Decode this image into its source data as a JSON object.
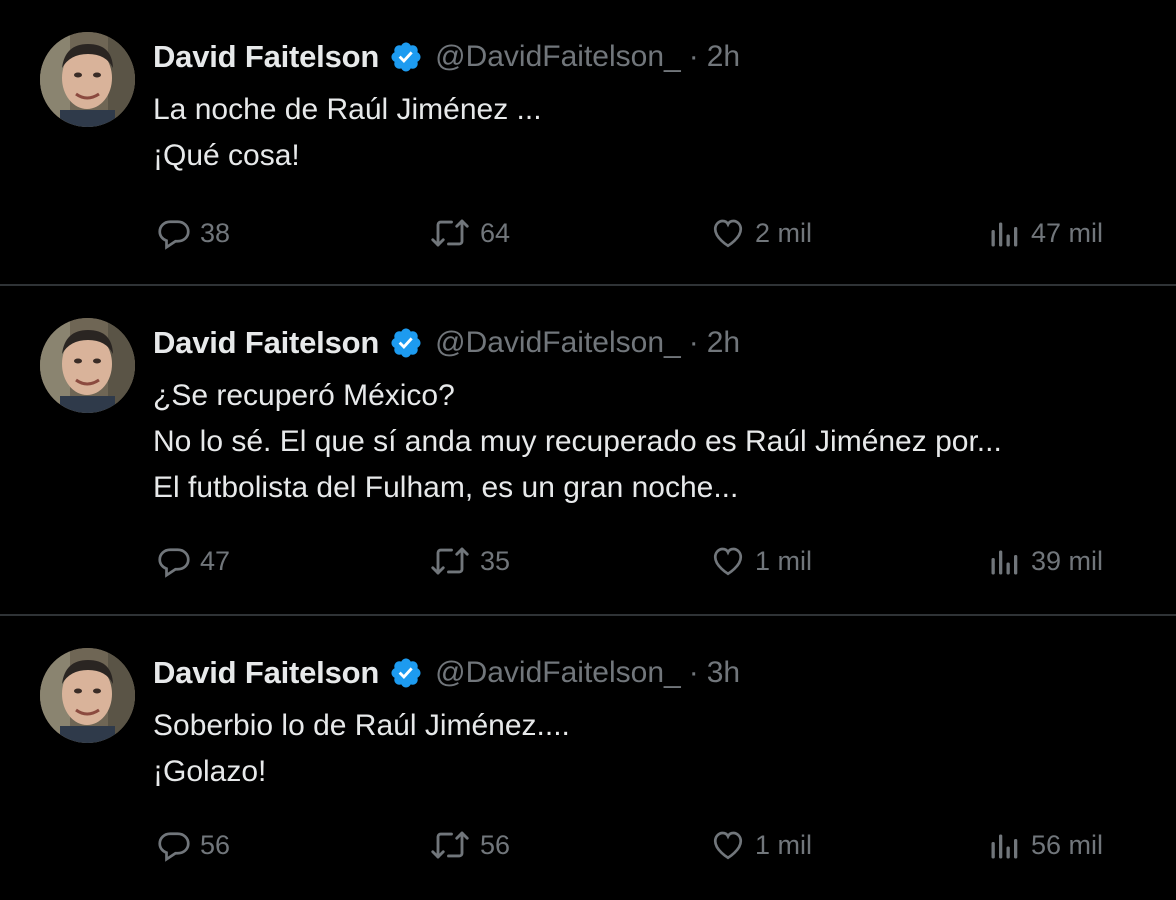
{
  "colors": {
    "background": "#000000",
    "text": "#e7e9ea",
    "secondary_text": "#71767b",
    "divider": "#2f3336",
    "verified_badge": "#1d9bf0"
  },
  "icons": {
    "reply": "speech-bubble",
    "retweet": "retweet-arrows",
    "like": "heart-outline",
    "views": "bar-chart",
    "verified": "verified-badge-check"
  },
  "tweets": [
    {
      "author": {
        "name": "David Faitelson",
        "handle": "@DavidFaitelson_",
        "separator": "·",
        "time": "2h"
      },
      "lines": [
        "La noche de Raúl Jiménez ...",
        "¡Qué cosa!"
      ],
      "stats": {
        "replies": "38",
        "retweets": "64",
        "likes": "2 mil",
        "views": "47 mil"
      }
    },
    {
      "author": {
        "name": "David Faitelson",
        "handle": "@DavidFaitelson_",
        "separator": "·",
        "time": "2h"
      },
      "lines": [
        "¿Se recuperó México?",
        "No lo sé. El que sí anda muy recuperado es Raúl Jiménez por...",
        "El futbolista del Fulham, es un gran noche..."
      ],
      "stats": {
        "replies": "47",
        "retweets": "35",
        "likes": "1 mil",
        "views": "39 mil"
      }
    },
    {
      "author": {
        "name": "David Faitelson",
        "handle": "@DavidFaitelson_",
        "separator": "·",
        "time": "3h"
      },
      "lines": [
        "Soberbio lo de Raúl Jiménez....",
        "¡Golazo!"
      ],
      "stats": {
        "replies": "56",
        "retweets": "56",
        "likes": "1 mil",
        "views": "56 mil"
      }
    }
  ]
}
